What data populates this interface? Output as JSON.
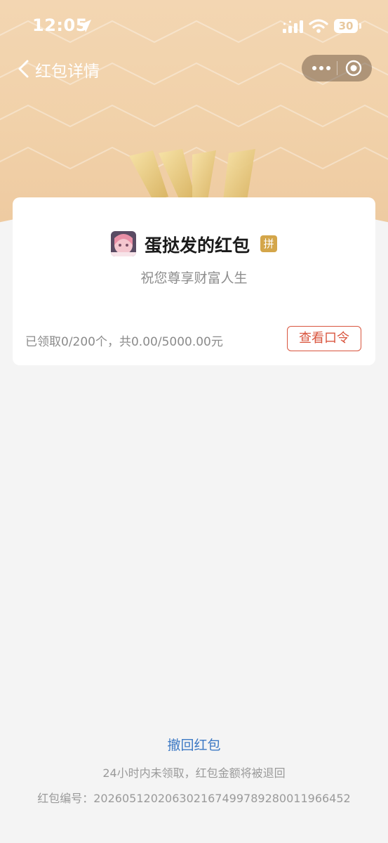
{
  "status_bar": {
    "time": "12:05",
    "battery": "30",
    "icons": [
      "location-arrow-icon",
      "signal-icon",
      "wifi-icon",
      "battery-icon"
    ]
  },
  "nav": {
    "back_icon": "chevron-left-icon",
    "title": "红包详情",
    "capsule_icons": [
      "more-dots-icon",
      "close-target-icon"
    ]
  },
  "card": {
    "sender_name": "蛋挞发的红包",
    "badge": "拼",
    "wish": "祝您尊享财富人生",
    "summary": "已领取0/200个，共0.00/5000.00元",
    "view_button": "查看口令"
  },
  "footer": {
    "withdraw": "撤回红包",
    "notice": "24小时内未领取，红包金额将被退回",
    "serial": "红包编号：202605120206302167499789280011966452"
  },
  "colors": {
    "header_bg": "#f1d1a9",
    "accent_red": "#d9553e",
    "link_blue": "#3c79c4",
    "badge_gold": "#d4a64a"
  }
}
